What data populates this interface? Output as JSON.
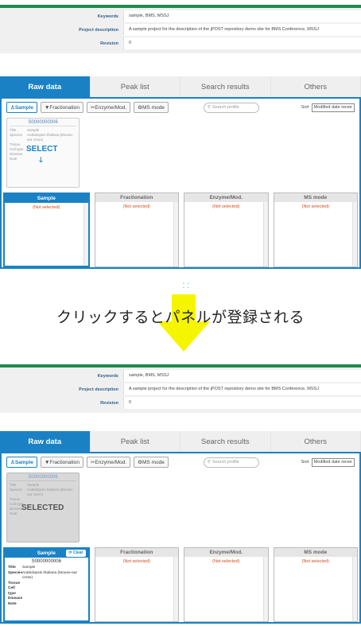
{
  "info": {
    "rows": [
      {
        "key": "Keywords",
        "value": "sample, BMS, MSSJ"
      },
      {
        "key": "Project description",
        "value": "A sample project for the description of the jPOST repository demo site for BMS Conference, MSSJ"
      },
      {
        "key": "Revision",
        "value": "0"
      }
    ]
  },
  "tabs": [
    "Raw data",
    "Peak list",
    "Search results",
    "Others"
  ],
  "toolbar": {
    "buttons": [
      "Sample",
      "Fractionation",
      "Enzyme/Mod.",
      "MS mode"
    ],
    "search_placeholder": "Search profile",
    "sort_label": "Sort",
    "sort_value": "Modified date never"
  },
  "card": {
    "id": "S0000000006",
    "fields": [
      {
        "k": "Title",
        "v": "Sample"
      },
      {
        "k": "Species",
        "v": "Arabidopsis thaliana (Mouse-ear cress)"
      },
      {
        "k": "Tissue",
        "v": ""
      },
      {
        "k": "Cell type",
        "v": ""
      },
      {
        "k": "Disease",
        "v": ""
      },
      {
        "k": "Note",
        "v": ""
      }
    ],
    "overlay_before": "SELECT",
    "overlay_after": "SELECTED"
  },
  "slots": {
    "headers": [
      "Sample",
      "Fractionation",
      "Enzyme/Mod.",
      "MS mode"
    ],
    "empty": "(Not selected)",
    "clear_label": "Clear"
  },
  "caption": "クリックするとパネルが登録される",
  "colors": {
    "accent": "#1a82c4",
    "arrow": "#f5f500",
    "green": "#1f8a4c",
    "not_selected": "#d04a1a"
  }
}
